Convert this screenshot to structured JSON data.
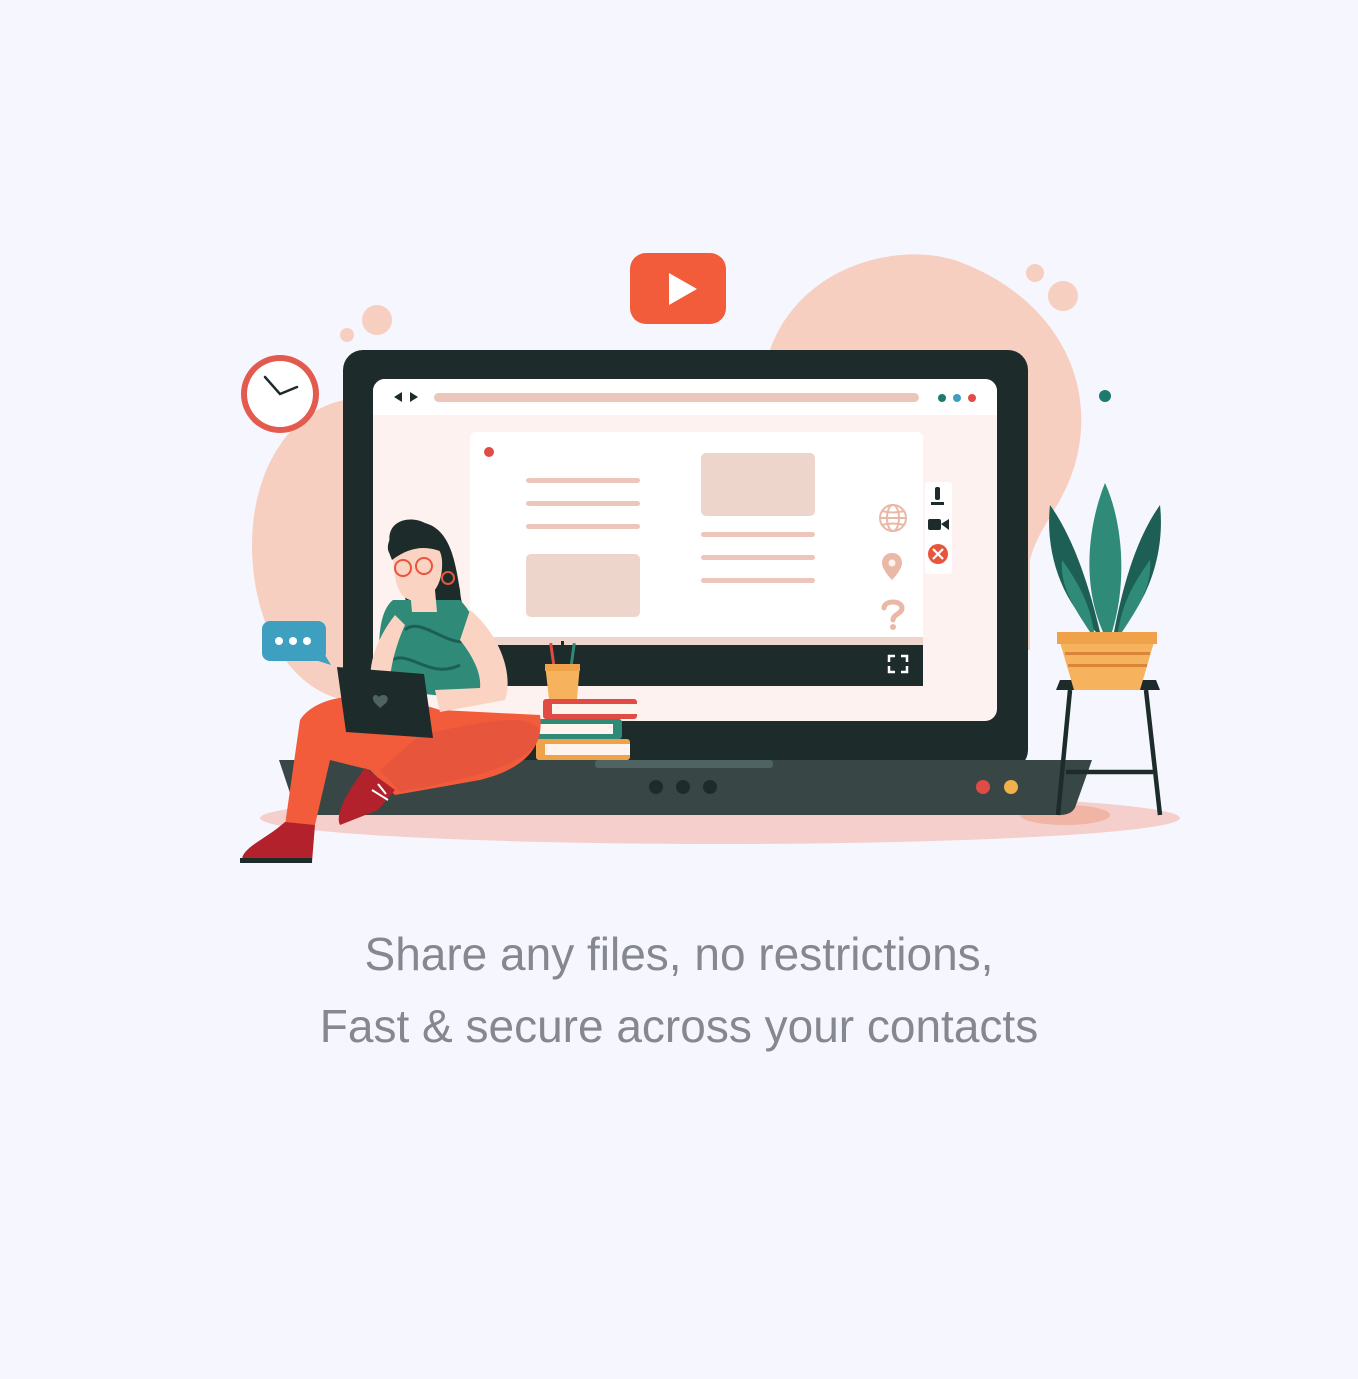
{
  "tagline": {
    "line1": "Share any files, no restrictions,",
    "line2": "Fast & secure across your contacts"
  },
  "colors": {
    "background": "#f6f7fe",
    "blob": "#f7cfc0",
    "laptop_frame": "#1d2b2a",
    "laptop_base": "#384746",
    "play_button": "#f25c3b",
    "text": "#858791"
  },
  "icons": [
    "play-icon",
    "clock-icon",
    "chat-bubble-icon",
    "globe-icon",
    "location-pin-icon",
    "question-mark-icon",
    "microphone-icon",
    "video-camera-icon",
    "close-icon",
    "fullscreen-icon",
    "heart-icon",
    "plant-icon"
  ]
}
